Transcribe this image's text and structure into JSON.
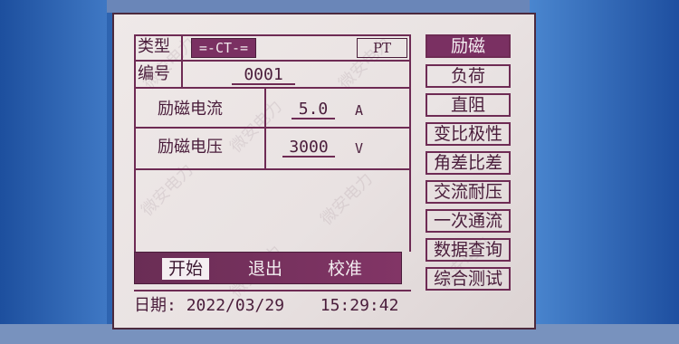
{
  "header": {
    "type_label": "类型",
    "ct_option": "=-CT-=",
    "pt_option": "PT",
    "number_label": "编号",
    "number_value": "0001"
  },
  "measurements": {
    "current": {
      "label": "励磁电流",
      "value": "5.0",
      "unit": "A"
    },
    "voltage": {
      "label": "励磁电压",
      "value": "3000",
      "unit": "V"
    }
  },
  "actions": {
    "start": "开始",
    "exit": "退出",
    "calibrate": "校准"
  },
  "menu": [
    {
      "label": "励磁"
    },
    {
      "label": "负荷"
    },
    {
      "label": "直阻"
    },
    {
      "label": "变比极性"
    },
    {
      "label": "角差比差"
    },
    {
      "label": "交流耐压"
    },
    {
      "label": "一次通流"
    },
    {
      "label": "数据查询"
    },
    {
      "label": "综合测试"
    }
  ],
  "status": {
    "date_label": "日期:",
    "date": "2022/03/29",
    "time": "15:29:42"
  },
  "watermark": "微安电力",
  "colors": {
    "screen_bg": "#ebe4e4",
    "accent": "#7a3062",
    "frame": "#6e2b54",
    "bezel": "#2e64b0"
  }
}
